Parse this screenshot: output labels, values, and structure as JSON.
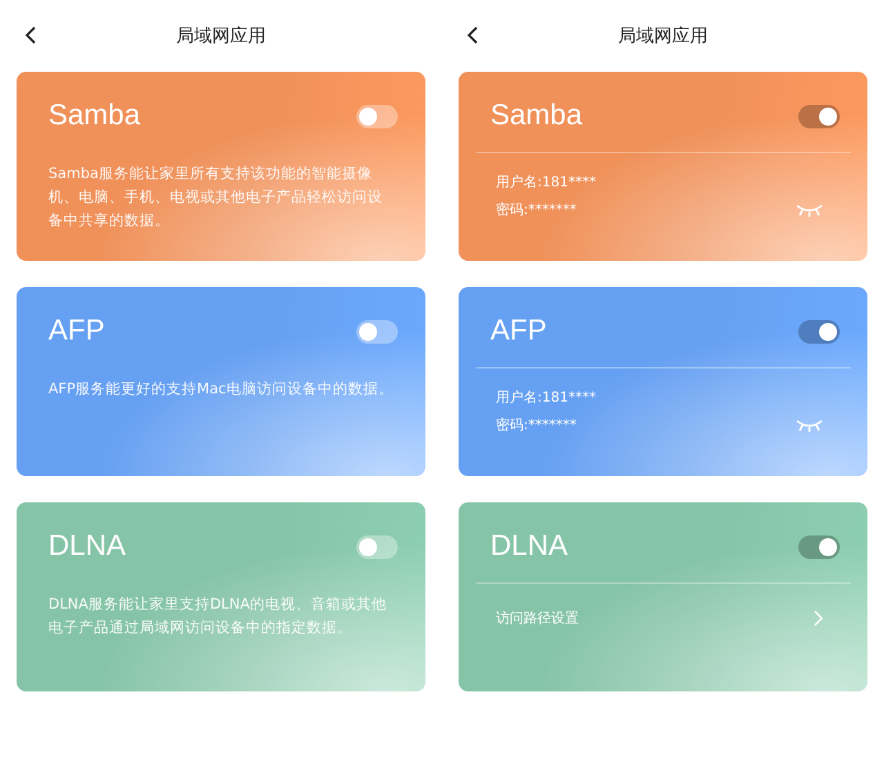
{
  "screens": [
    {
      "title": "局域网应用",
      "cards": [
        {
          "name": "Samba",
          "color": "#f0915a",
          "on": false,
          "kind": "description",
          "description": "Samba服务能让家里所有支持该功能的智能摄像机、电脑、手机、电视或其他电子产品轻松访问设备中共享的数据。"
        },
        {
          "name": "AFP",
          "color": "#66a0f2",
          "on": false,
          "kind": "description",
          "description": "AFP服务能更好的支持Mac电脑访问设备中的数据。"
        },
        {
          "name": "DLNA",
          "color": "#86c4a8",
          "on": false,
          "kind": "description",
          "description": "DLNA服务能让家里支持DLNA的电视、音箱或其他电子产品通过局域网访问设备中的指定数据。"
        }
      ]
    },
    {
      "title": "局域网应用",
      "cards": [
        {
          "name": "Samba",
          "color": "#f0915a",
          "on": true,
          "kind": "credentials",
          "username": "用户名:181****",
          "password": "密码:*******"
        },
        {
          "name": "AFP",
          "color": "#66a0f2",
          "on": true,
          "kind": "credentials",
          "username": "用户名:181****",
          "password": "密码:*******"
        },
        {
          "name": "DLNA",
          "color": "#86c4a8",
          "on": true,
          "kind": "link",
          "link": "访问路径设置"
        }
      ]
    }
  ]
}
